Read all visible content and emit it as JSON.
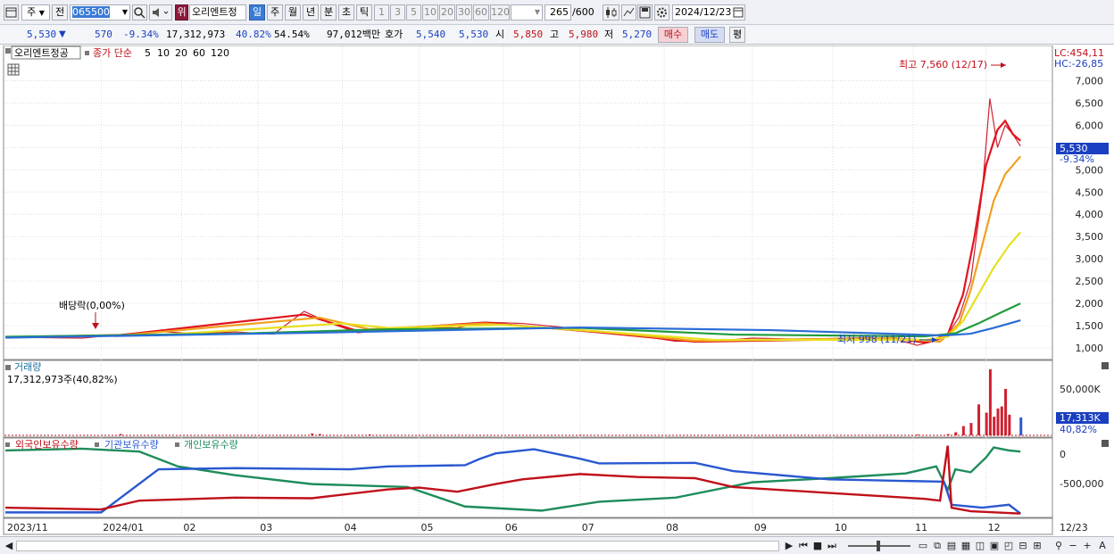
{
  "toolbar": {
    "period_label": "주",
    "jeon_label": "전",
    "stock_code": "065500",
    "rank_badge": "위",
    "stock_name": "오리엔트정",
    "period_tabs": [
      "일",
      "주",
      "월",
      "년",
      "분",
      "초",
      "틱"
    ],
    "active_tab": "일",
    "intervals": [
      "1",
      "3",
      "5",
      "10",
      "20",
      "30",
      "60",
      "120"
    ],
    "count_current": "265",
    "count_total": "/600",
    "date": "2024/12/23"
  },
  "quote": {
    "price": "5,530",
    "change_arrow": "▼",
    "change": "570",
    "change_pct": "-9.34%",
    "volume": "17,312,973",
    "turnover_pct": "40.82%",
    "foreign_pct": "54.54%",
    "amount": "97,012백만",
    "hoga_label": "호가",
    "hoga_ask": "5,540",
    "hoga_bid": "5,530",
    "open_label": "시",
    "open": "5,850",
    "high_label": "고",
    "high": "5,980",
    "low_label": "저",
    "low": "5,270",
    "buy_label": "매수",
    "sell_label": "매도",
    "eval_label": "평"
  },
  "price_panel": {
    "name_tag": "오리엔트정공",
    "ma_title": "종가 단순",
    "ma_periods": [
      {
        "label": "5",
        "color": "#e0141e"
      },
      {
        "label": "10",
        "color": "#f0a020"
      },
      {
        "label": "20",
        "color": "#e8e020"
      },
      {
        "label": "60",
        "color": "#1e9b3c"
      },
      {
        "label": "120",
        "color": "#2a6dd6"
      }
    ],
    "lc": "LC:454,11",
    "hc": "HC:-26,85",
    "high_annotation": "최고 7,560 (12/17)",
    "low_annotation": "최저 998 (11/21)",
    "dividend_annotation": "배당락(0,00%)",
    "current_tag": "5,530",
    "current_pct": "-9.34%"
  },
  "volume_panel": {
    "title": "거래량",
    "info": "17,312,973주(40,82%)",
    "tick_label": "50,000K",
    "current_tag": "17,313K",
    "current_pct": "40,82%"
  },
  "holdings_panel": {
    "legend": [
      {
        "label": "외국인보유수량",
        "color": "#c0101a"
      },
      {
        "label": "기관보유수량",
        "color": "#2a58d0"
      },
      {
        "label": "개인보유수량",
        "color": "#1e8c5a"
      }
    ],
    "tick_labels": [
      "0",
      "-500,000"
    ]
  },
  "x_axis": [
    "2023/11",
    "2024/01",
    "02",
    "03",
    "04",
    "05",
    "06",
    "07",
    "08",
    "09",
    "10",
    "11",
    "12",
    "12/23"
  ],
  "chart_data": {
    "type": "line",
    "title": "오리엔트정공",
    "y_ticks": [
      1000,
      1500,
      2000,
      2500,
      3000,
      3500,
      4000,
      4500,
      5000,
      5500,
      6000,
      6500,
      7000
    ],
    "y_tick_labels": [
      "1,000",
      "1,500",
      "2,000",
      "2,500",
      "3,000",
      "3,500",
      "4,000",
      "4,500",
      "5,000",
      "5,500",
      "6,000",
      "6,500",
      "7,000"
    ],
    "ylim": [
      740,
      7790
    ],
    "x_index_range": [
      0,
      265
    ],
    "price_points": [
      [
        0,
        1240
      ],
      [
        10,
        1230
      ],
      [
        20,
        1220
      ],
      [
        30,
        1300
      ],
      [
        40,
        1370
      ],
      [
        50,
        1320
      ],
      [
        60,
        1360
      ],
      [
        70,
        1310
      ],
      [
        78,
        1820
      ],
      [
        85,
        1550
      ],
      [
        92,
        1340
      ],
      [
        100,
        1400
      ],
      [
        110,
        1470
      ],
      [
        118,
        1450
      ],
      [
        125,
        1580
      ],
      [
        135,
        1550
      ],
      [
        145,
        1470
      ],
      [
        155,
        1350
      ],
      [
        165,
        1280
      ],
      [
        175,
        1150
      ],
      [
        185,
        1150
      ],
      [
        195,
        1220
      ],
      [
        205,
        1200
      ],
      [
        215,
        1210
      ],
      [
        225,
        1230
      ],
      [
        232,
        1200
      ],
      [
        238,
        1060
      ],
      [
        243,
        1160
      ],
      [
        246,
        1300
      ],
      [
        249,
        1700
      ],
      [
        252,
        2500
      ],
      [
        255,
        4500
      ],
      [
        257,
        6600
      ],
      [
        259,
        5500
      ],
      [
        261,
        6000
      ],
      [
        263,
        5800
      ],
      [
        265,
        5530
      ]
    ],
    "series": [
      {
        "name": "5",
        "color": "#e0141e",
        "points": [
          [
            0,
            1240
          ],
          [
            30,
            1290
          ],
          [
            78,
            1750
          ],
          [
            92,
            1380
          ],
          [
            125,
            1570
          ],
          [
            155,
            1350
          ],
          [
            180,
            1140
          ],
          [
            232,
            1210
          ],
          [
            240,
            1120
          ],
          [
            246,
            1300
          ],
          [
            250,
            2200
          ],
          [
            253,
            3500
          ],
          [
            256,
            5100
          ],
          [
            259,
            5900
          ],
          [
            261,
            6100
          ],
          [
            263,
            5800
          ],
          [
            265,
            5650
          ]
        ]
      },
      {
        "name": "10",
        "color": "#f0a020",
        "points": [
          [
            0,
            1240
          ],
          [
            30,
            1280
          ],
          [
            82,
            1680
          ],
          [
            95,
            1420
          ],
          [
            125,
            1550
          ],
          [
            155,
            1370
          ],
          [
            180,
            1160
          ],
          [
            232,
            1220
          ],
          [
            244,
            1140
          ],
          [
            249,
            1550
          ],
          [
            252,
            2300
          ],
          [
            255,
            3300
          ],
          [
            258,
            4300
          ],
          [
            261,
            4900
          ],
          [
            265,
            5300
          ]
        ]
      },
      {
        "name": "20",
        "color": "#e8e020",
        "points": [
          [
            0,
            1240
          ],
          [
            40,
            1290
          ],
          [
            88,
            1550
          ],
          [
            100,
            1450
          ],
          [
            130,
            1520
          ],
          [
            160,
            1340
          ],
          [
            185,
            1180
          ],
          [
            240,
            1180
          ],
          [
            246,
            1250
          ],
          [
            250,
            1600
          ],
          [
            254,
            2200
          ],
          [
            258,
            2800
          ],
          [
            262,
            3300
          ],
          [
            265,
            3600
          ]
        ]
      },
      {
        "name": "60",
        "color": "#1e9b3c",
        "points": [
          [
            0,
            1250
          ],
          [
            60,
            1320
          ],
          [
            100,
            1420
          ],
          [
            150,
            1450
          ],
          [
            190,
            1300
          ],
          [
            240,
            1260
          ],
          [
            248,
            1330
          ],
          [
            254,
            1550
          ],
          [
            260,
            1800
          ],
          [
            265,
            2000
          ]
        ]
      },
      {
        "name": "120",
        "color": "#2a6dd6",
        "points": [
          [
            0,
            1230
          ],
          [
            80,
            1340
          ],
          [
            150,
            1460
          ],
          [
            200,
            1400
          ],
          [
            245,
            1280
          ],
          [
            252,
            1320
          ],
          [
            258,
            1450
          ],
          [
            265,
            1620
          ]
        ]
      }
    ],
    "volume": {
      "ylabel": "거래량",
      "ylim": [
        0,
        70000
      ],
      "bars": [
        [
          30,
          1200
        ],
        [
          80,
          1800
        ],
        [
          82,
          1200
        ],
        [
          95,
          900
        ],
        [
          150,
          600
        ],
        [
          238,
          800
        ],
        [
          246,
          1200
        ],
        [
          248,
          3000
        ],
        [
          250,
          9000
        ],
        [
          252,
          12000
        ],
        [
          254,
          30000
        ],
        [
          256,
          22000
        ],
        [
          257,
          64000
        ],
        [
          258,
          18000
        ],
        [
          259,
          26000
        ],
        [
          260,
          28000
        ],
        [
          261,
          45000
        ],
        [
          262,
          20000
        ],
        [
          265,
          17313
        ]
      ]
    },
    "holdings": {
      "ylim": [
        -1150000,
        150000
      ],
      "foreign": [
        [
          0,
          -1000000
        ],
        [
          25,
          -1030000
        ],
        [
          35,
          -880000
        ],
        [
          60,
          -830000
        ],
        [
          80,
          -840000
        ],
        [
          100,
          -690000
        ],
        [
          108,
          -660000
        ],
        [
          118,
          -730000
        ],
        [
          128,
          -600000
        ],
        [
          135,
          -520000
        ],
        [
          150,
          -430000
        ],
        [
          165,
          -480000
        ],
        [
          180,
          -500000
        ],
        [
          190,
          -650000
        ],
        [
          215,
          -750000
        ],
        [
          240,
          -850000
        ],
        [
          244,
          -880000
        ],
        [
          246,
          50000
        ],
        [
          247,
          -1000000
        ],
        [
          252,
          -1060000
        ],
        [
          265,
          -1100000
        ]
      ],
      "institution": [
        [
          0,
          -1080000
        ],
        [
          25,
          -1080000
        ],
        [
          40,
          -350000
        ],
        [
          60,
          -330000
        ],
        [
          90,
          -350000
        ],
        [
          100,
          -300000
        ],
        [
          120,
          -280000
        ],
        [
          124,
          -170000
        ],
        [
          128,
          -80000
        ],
        [
          138,
          -10000
        ],
        [
          150,
          -170000
        ],
        [
          155,
          -250000
        ],
        [
          180,
          -240000
        ],
        [
          190,
          -380000
        ],
        [
          215,
          -520000
        ],
        [
          245,
          -560000
        ],
        [
          247,
          -950000
        ],
        [
          255,
          -1000000
        ],
        [
          262,
          -950000
        ],
        [
          265,
          -1100000
        ]
      ],
      "individual": [
        [
          0,
          -30000
        ],
        [
          20,
          0
        ],
        [
          35,
          -50000
        ],
        [
          45,
          -300000
        ],
        [
          60,
          -450000
        ],
        [
          80,
          -600000
        ],
        [
          105,
          -650000
        ],
        [
          120,
          -980000
        ],
        [
          140,
          -1050000
        ],
        [
          155,
          -900000
        ],
        [
          175,
          -830000
        ],
        [
          195,
          -570000
        ],
        [
          215,
          -500000
        ],
        [
          235,
          -420000
        ],
        [
          243,
          -300000
        ],
        [
          246,
          -700000
        ],
        [
          248,
          -350000
        ],
        [
          252,
          -400000
        ],
        [
          256,
          -150000
        ],
        [
          258,
          20000
        ],
        [
          262,
          -30000
        ],
        [
          265,
          -50000
        ]
      ]
    }
  }
}
